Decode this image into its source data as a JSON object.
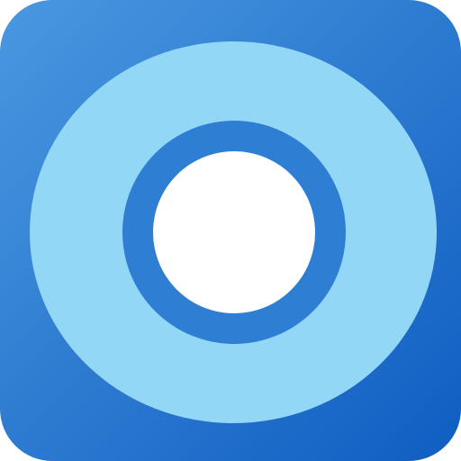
{
  "icon": {
    "name": "target-ring-app-icon",
    "description_hidden": "",
    "colors": {
      "background_top_left": "#4A98E0",
      "background_bottom_right": "#0F5DC1",
      "outer_ring": "#93D7F6",
      "inner_ring": "#2E7ED3",
      "center": "#FFFFFF"
    }
  }
}
